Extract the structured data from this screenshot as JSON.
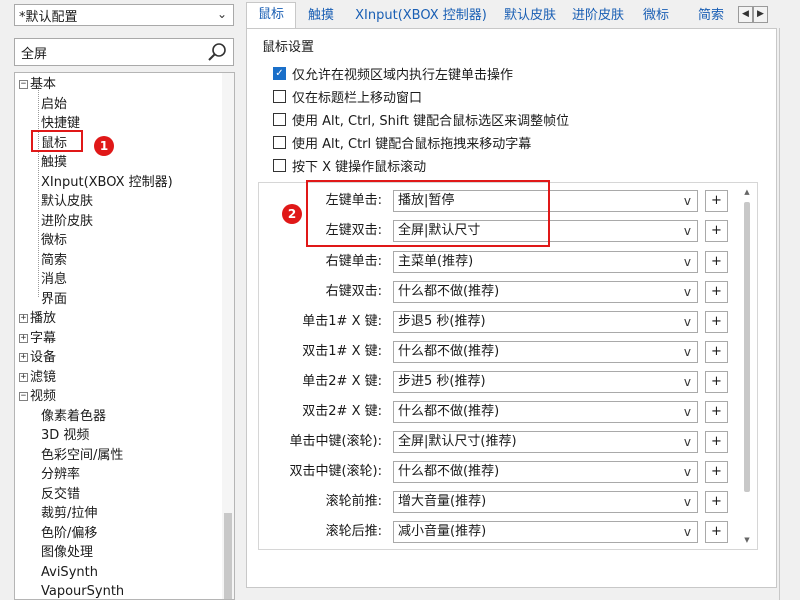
{
  "profile": {
    "value": "*默认配置"
  },
  "search": {
    "value": "全屏"
  },
  "tree": {
    "root_basic": "基本",
    "basic_children": [
      "启始",
      "快捷键",
      "鼠标",
      "触摸",
      "XInput(XBOX 控制器)",
      "默认皮肤",
      "进阶皮肤",
      "微标",
      "简索",
      "消息",
      "界面"
    ],
    "collapsed_roots": [
      "播放",
      "字幕",
      "设备",
      "滤镜"
    ],
    "root_video": "视频",
    "video_children": [
      "像素着色器",
      "3D 视频",
      "色彩空间/属性",
      "分辨率",
      "反交错",
      "裁剪/拉伸",
      "色阶/偏移",
      "图像处理",
      "AviSynth",
      "VapourSynth"
    ]
  },
  "tabs": [
    "鼠标",
    "触摸",
    "XInput(XBOX 控制器)",
    "默认皮肤",
    "进阶皮肤",
    "微标",
    "简索"
  ],
  "panel": {
    "caption": "鼠标设置",
    "checkboxes": [
      {
        "label": "仅允许在视频区域内执行左键单击操作",
        "checked": true
      },
      {
        "label": "仅在标题栏上移动窗口",
        "checked": false
      },
      {
        "label": "使用 Alt, Ctrl, Shift 键配合鼠标选区来调整帧位",
        "checked": false
      },
      {
        "label": "使用 Alt, Ctrl 键配合鼠标拖拽来移动字幕",
        "checked": false
      },
      {
        "label": "按下 X 键操作鼠标滚动",
        "checked": false
      }
    ],
    "bindings": [
      {
        "label": "左键单击:",
        "value": "播放|暂停"
      },
      {
        "label": "左键双击:",
        "value": "全屏|默认尺寸"
      },
      {
        "label": "右键单击:",
        "value": "主菜单(推荐)"
      },
      {
        "label": "右键双击:",
        "value": "什么都不做(推荐)"
      },
      {
        "label": "单击1# X 键:",
        "value": "步退5 秒(推荐)"
      },
      {
        "label": "双击1# X 键:",
        "value": "什么都不做(推荐)"
      },
      {
        "label": "单击2# X 键:",
        "value": "步进5 秒(推荐)"
      },
      {
        "label": "双击2# X 键:",
        "value": "什么都不做(推荐)"
      },
      {
        "label": "单击中键(滚轮):",
        "value": "全屏|默认尺寸(推荐)"
      },
      {
        "label": "双击中键(滚轮):",
        "value": "什么都不做(推荐)"
      },
      {
        "label": "滚轮前推:",
        "value": "增大音量(推荐)"
      },
      {
        "label": "滚轮后推:",
        "value": "减小音量(推荐)"
      }
    ],
    "plus_label": "+",
    "chevron": "v"
  },
  "annotations": {
    "one": "1",
    "two": "2"
  },
  "colors": {
    "annotation": "#e01818",
    "tab_text": "#1a5fb4",
    "checkbox": "#1a6fc9"
  }
}
